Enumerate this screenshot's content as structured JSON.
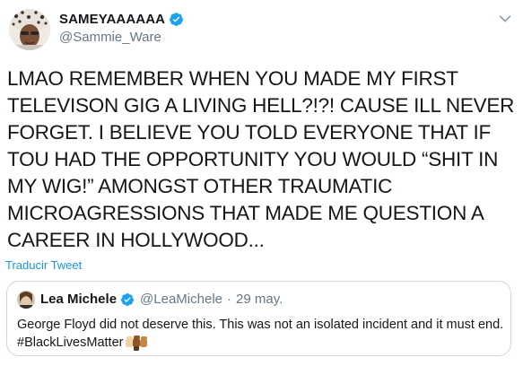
{
  "author": {
    "display_name": "SAMEYAAAAAA",
    "handle": "@Sammie_Ware"
  },
  "tweet": {
    "text": "LMAO REMEMBER WHEN YOU MADE MY FIRST TELEVISON GIG A LIVING HELL?!?! CAUSE ILL NEVER FORGET. I BELIEVE YOU TOLD EVERYONE THAT IF TOU HAD THE OPPORTUNITY YOU WOULD “SHIT IN MY WIG!” AMONGST OTHER TRAUMATIC MICROAGRESSIONS THAT MADE ME QUESTION A CAREER IN HOLLYWOOD...",
    "translate_label": "Traducir Tweet"
  },
  "quoted_tweet": {
    "display_name": "Lea Michele",
    "handle": "@LeaMichele",
    "separator": "·",
    "date": "29 may.",
    "text": "George Floyd did not deserve this. This was not an isolated incident and it must end. #BlackLivesMatter",
    "emoji": "raised-fist-skin-tones-icon"
  },
  "colors": {
    "verified_blue": "#1da1f2",
    "link_blue": "#1b95e0",
    "secondary_text": "#657786",
    "border": "#ccd6dd"
  },
  "icons": {
    "verified": "verified-badge-icon",
    "menu": "chevron-down-icon"
  }
}
